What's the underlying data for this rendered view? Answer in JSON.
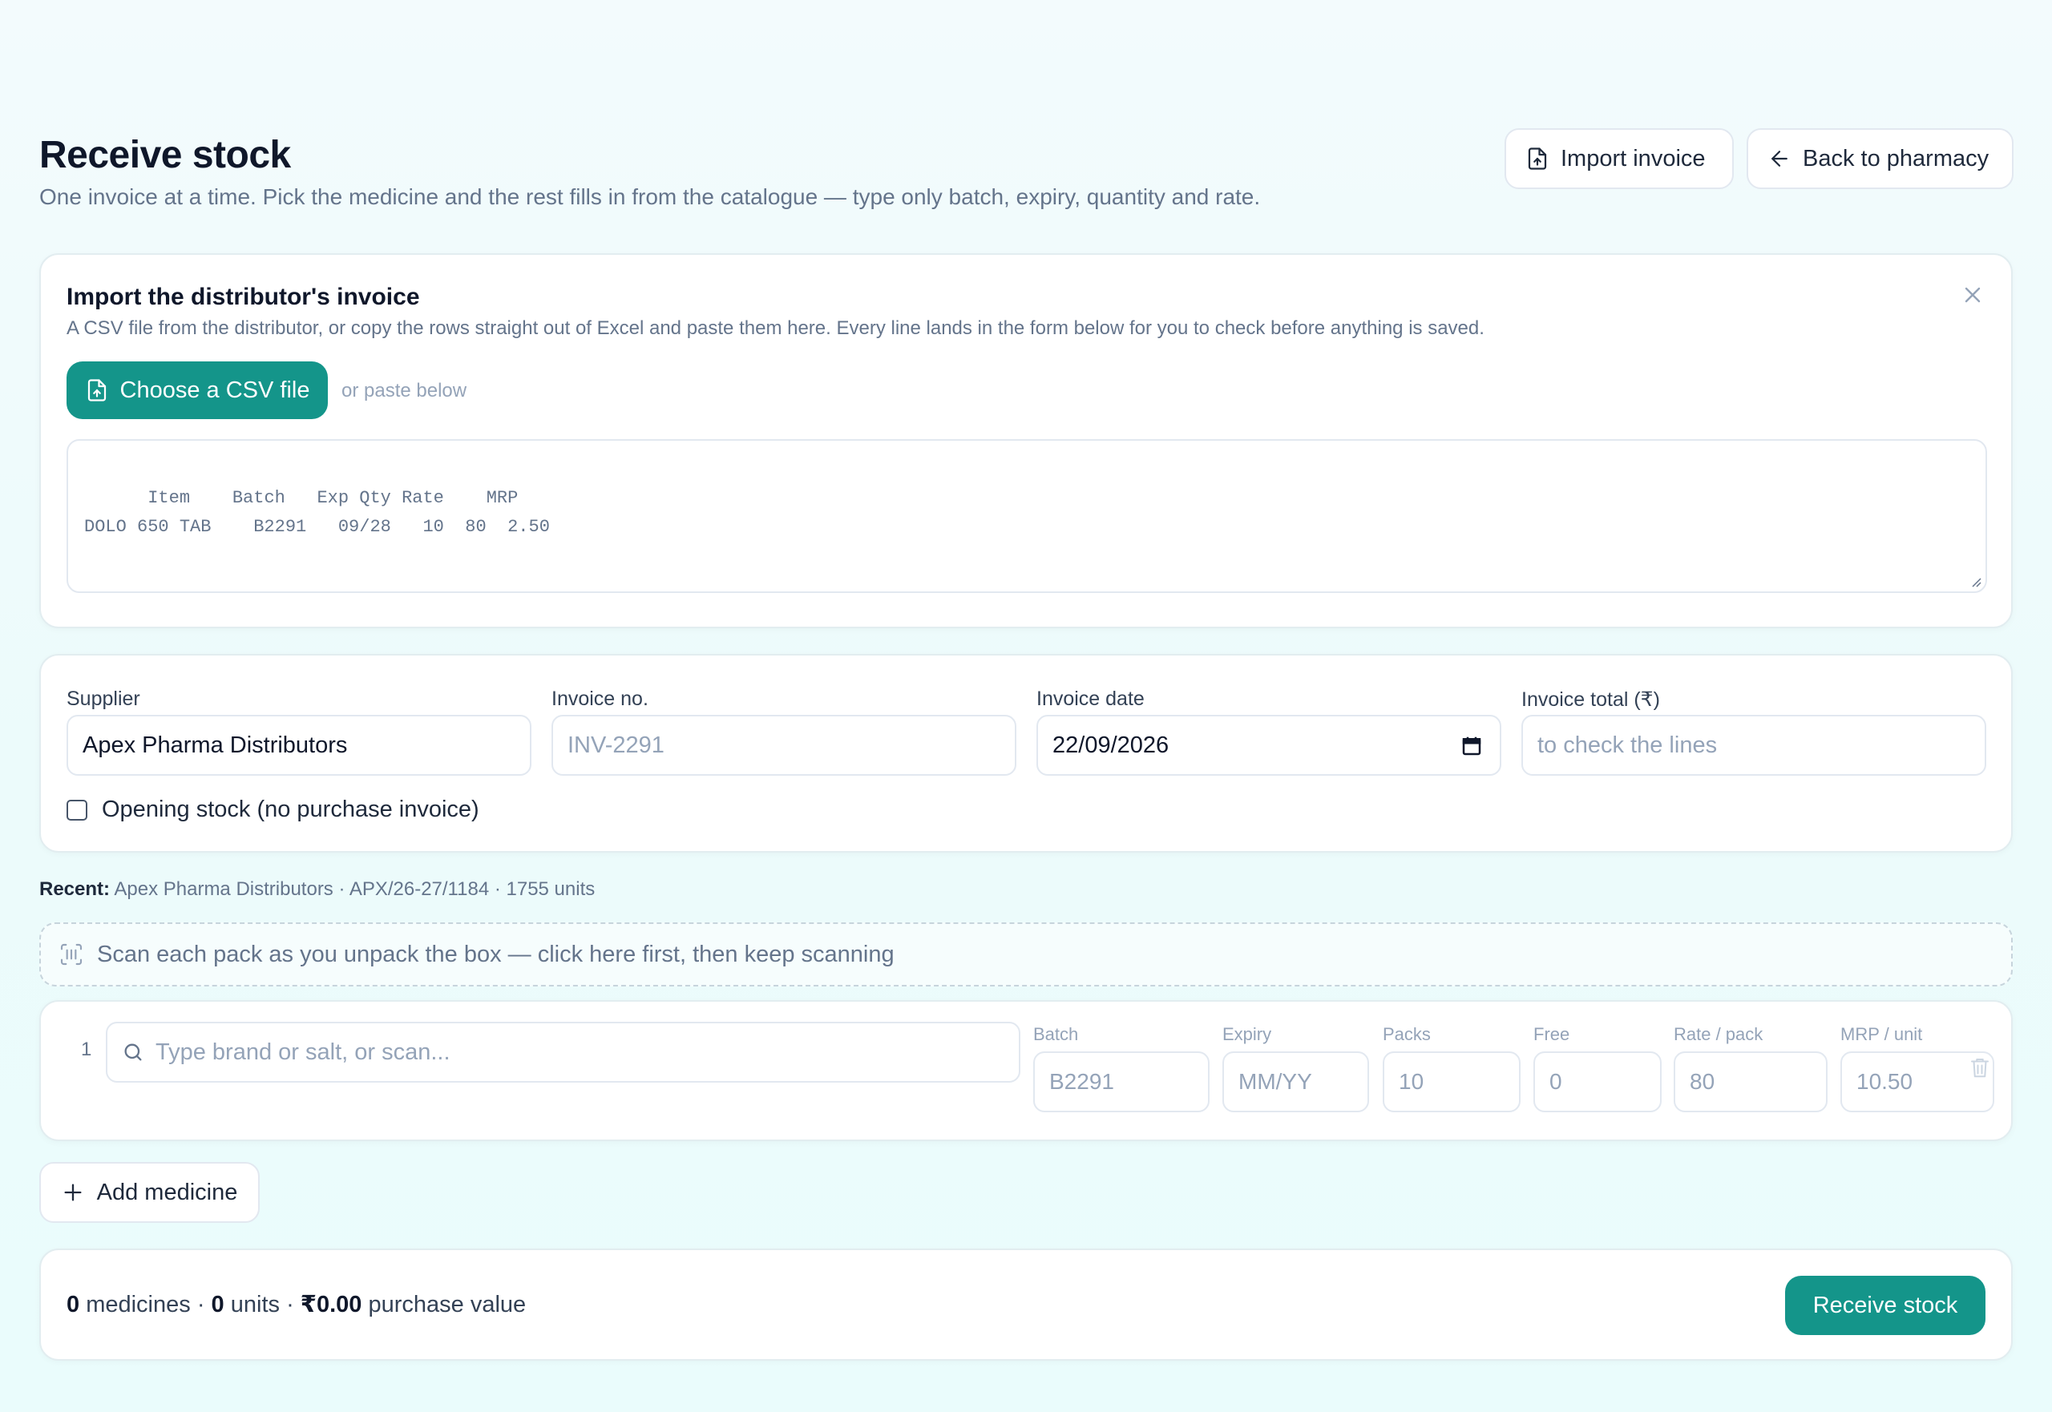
{
  "header": {
    "title": "Receive stock",
    "subtitle": "One invoice at a time. Pick the medicine and the rest fills in from the catalogue — type only batch, expiry, quantity and rate.",
    "import_label": "Import invoice",
    "back_label": "Back to pharmacy"
  },
  "import": {
    "title": "Import the distributor's invoice",
    "description": "A CSV file from the distributor, or copy the rows straight out of Excel and paste them here. Every line lands in the form below for you to check before anything is saved.",
    "csv_button": "Choose a CSV file",
    "paste_hint": "or paste below",
    "paste_placeholder": "Item    Batch   Exp Qty Rate    MRP\nDOLO 650 TAB    B2291   09/28   10  80  2.50"
  },
  "invoice": {
    "supplier_label": "Supplier",
    "supplier_value": "Apex Pharma Distributors",
    "invoice_no_label": "Invoice no.",
    "invoice_no_placeholder": "INV-2291",
    "invoice_date_label": "Invoice date",
    "invoice_date_value": "22/09/2026",
    "invoice_total_label": "Invoice total (₹)",
    "invoice_total_placeholder": "to check the lines",
    "opening_stock_label": "Opening stock (no purchase invoice)",
    "opening_stock_checked": false
  },
  "recent": {
    "label": "Recent:",
    "text": "Apex Pharma Distributors · APX/26-27/1184 · 1755 units"
  },
  "scan": {
    "text": "Scan each pack as you unpack the box — click here first, then keep scanning"
  },
  "line": {
    "number": "1",
    "search_placeholder": "Type brand or salt, or scan...",
    "columns": {
      "batch": {
        "label": "Batch",
        "placeholder": "B2291"
      },
      "expiry": {
        "label": "Expiry",
        "placeholder": "MM/YY"
      },
      "packs": {
        "label": "Packs",
        "placeholder": "10"
      },
      "free": {
        "label": "Free",
        "placeholder": "0"
      },
      "rate": {
        "label": "Rate / pack",
        "placeholder": "80"
      },
      "mrp": {
        "label": "MRP / unit",
        "placeholder": "10.50"
      }
    }
  },
  "add_medicine_label": "Add medicine",
  "summary": {
    "medicines_count": "0",
    "medicines_label": "medicines ·",
    "units_count": "0",
    "units_label": "units ·",
    "value": "₹0.00",
    "value_label": "purchase value",
    "receive_button": "Receive stock"
  },
  "colors": {
    "accent": "#14958a",
    "text_primary": "#0f172a",
    "text_muted": "#64748b",
    "border": "#e2e8f0"
  },
  "icons": {
    "import": "file-upload-icon",
    "back": "arrow-left-icon",
    "close": "close-icon",
    "scan": "barcode-scan-icon",
    "search": "search-icon",
    "trash": "trash-icon",
    "add": "plus-icon",
    "calendar": "calendar-icon"
  }
}
